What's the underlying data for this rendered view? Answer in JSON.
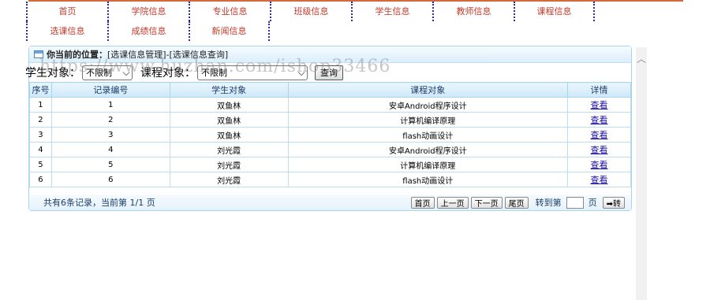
{
  "nav": {
    "row1": [
      "首页",
      "学院信息",
      "专业信息",
      "班级信息",
      "学生信息",
      "教师信息",
      "课程信息"
    ],
    "row2": [
      "选课信息",
      "成绩信息",
      "新闻信息"
    ]
  },
  "breadcrumb": {
    "prefix": "你当前的位置：",
    "path": "[选课信息管理]-[选课信息查询]"
  },
  "filter": {
    "student_label": "学生对象：",
    "student_value": "不限制",
    "course_label": "课程对象：",
    "course_value": "不限制",
    "query_button": "查询"
  },
  "watermark": "https://www.huzhan.com/ishop33466",
  "table": {
    "headers": [
      "序号",
      "记录编号",
      "学生对象",
      "课程对象",
      "详情"
    ],
    "rows": [
      {
        "no": "1",
        "id": "1",
        "student": "双鱼林",
        "course": "安卓Android程序设计",
        "action": "查看"
      },
      {
        "no": "2",
        "id": "2",
        "student": "双鱼林",
        "course": "计算机编译原理",
        "action": "查看"
      },
      {
        "no": "3",
        "id": "3",
        "student": "双鱼林",
        "course": "flash动画设计",
        "action": "查看"
      },
      {
        "no": "4",
        "id": "4",
        "student": "刘光霞",
        "course": "安卓Android程序设计",
        "action": "查看"
      },
      {
        "no": "5",
        "id": "5",
        "student": "刘光霞",
        "course": "计算机编译原理",
        "action": "查看"
      },
      {
        "no": "6",
        "id": "6",
        "student": "刘光霞",
        "course": "flash动画设计",
        "action": "查看"
      }
    ]
  },
  "footer": {
    "summary": "共有6条记录，当前第 1/1 页",
    "first": "首页",
    "prev": "上一页",
    "next": "下一页",
    "last": "尾页",
    "goto_label": "转到第",
    "page_unit": "页",
    "go": "➡转"
  },
  "colors": {
    "nav_text": "#c0392b",
    "nav_divider": "#2a2ab0",
    "panel_border": "#a9d4ee",
    "link": "#1a0dab"
  }
}
